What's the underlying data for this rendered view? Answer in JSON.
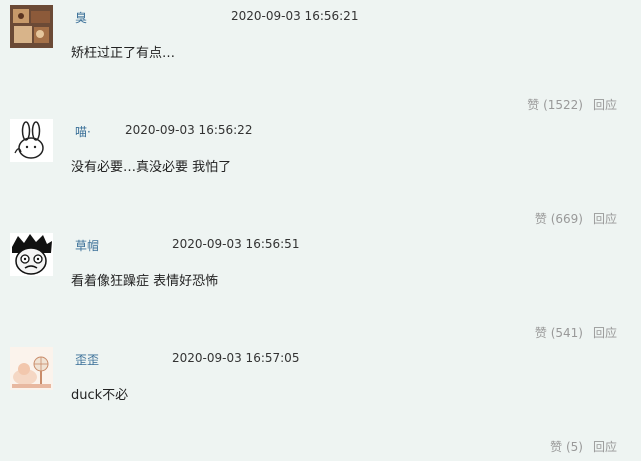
{
  "comments": [
    {
      "username": "臭",
      "time": "2020-09-03 16:56:21",
      "text": "矫枉过正了有点…",
      "like_label": "赞",
      "like_count": "(1522)",
      "reply_label": "回应",
      "avatar_icon": "food-photo-icon"
    },
    {
      "username": "喵·",
      "time": "2020-09-03 16:56:22",
      "text": "没有必要…真没必要 我怕了",
      "like_label": "赞",
      "like_count": "(669)",
      "reply_label": "回应",
      "avatar_icon": "rabbit-doodle-icon"
    },
    {
      "username": "草帽",
      "time": "2020-09-03 16:56:51",
      "text": "看着像狂躁症 表情好恐怖",
      "like_label": "赞",
      "like_count": "(541)",
      "reply_label": "回应",
      "avatar_icon": "manga-face-icon"
    },
    {
      "username": "歪歪",
      "time": "2020-09-03 16:57:05",
      "text": "duck不必",
      "like_label": "赞",
      "like_count": "(5)",
      "reply_label": "回应",
      "avatar_icon": "cartoon-fan-icon"
    }
  ]
}
